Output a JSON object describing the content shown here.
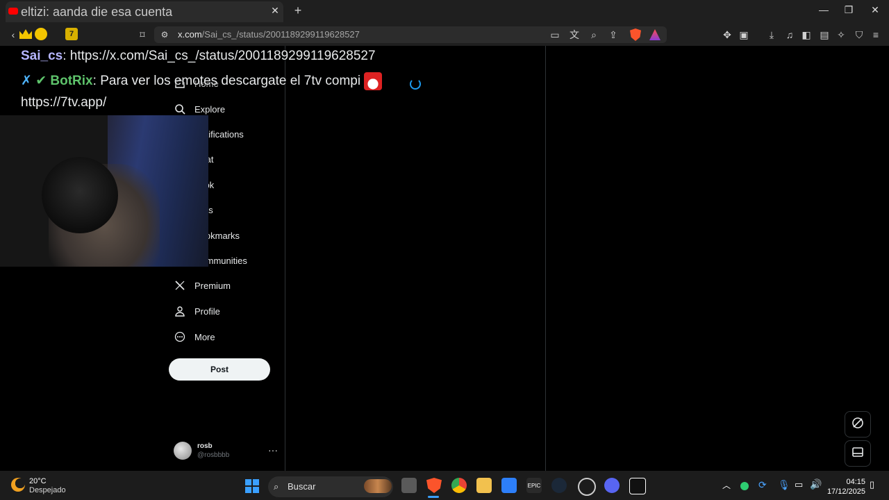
{
  "browser": {
    "tab_title": "eltizi: aanda die esa cuenta",
    "url_host": "x.com",
    "url_path": "/Sai_cs_/status/2001189299119628527"
  },
  "sidebar": {
    "items": [
      {
        "label": "Home",
        "icon": "home-icon"
      },
      {
        "label": "Explore",
        "icon": "search-icon"
      },
      {
        "label": "Notifications",
        "icon": "bell-icon"
      },
      {
        "label": "Chat",
        "icon": "chat-icon"
      },
      {
        "label": "Grok",
        "icon": "grok-icon"
      },
      {
        "label": "Lists",
        "icon": "list-icon"
      },
      {
        "label": "Bookmarks",
        "icon": "bookmark-icon"
      },
      {
        "label": "Communities",
        "icon": "communities-icon"
      },
      {
        "label": "Premium",
        "icon": "x-logo-icon"
      },
      {
        "label": "Profile",
        "icon": "person-icon"
      },
      {
        "label": "More",
        "icon": "more-circle-icon"
      }
    ],
    "post_label": "Post",
    "account": {
      "name": "rosb",
      "handle": "@rosbbbb"
    }
  },
  "chat_overlay": {
    "line1_user": "Sai_cs",
    "line1_text": ": https://x.com/Sai_cs_/status/2001189299119628527",
    "line2_user": "BotRix",
    "line2_text": ": Para ver los emotes descargate el 7tv compi",
    "line3_text": "https://7tv.app/"
  },
  "taskbar": {
    "weather_temp": "20°C",
    "weather_desc": "Despejado",
    "search_label": "Buscar",
    "time": "04:15",
    "date": "17/12/2025"
  },
  "colors": {
    "accent": "#1d9bf0",
    "chat_user1": "#b6b6ff",
    "chat_user2": "#5ec36b"
  }
}
